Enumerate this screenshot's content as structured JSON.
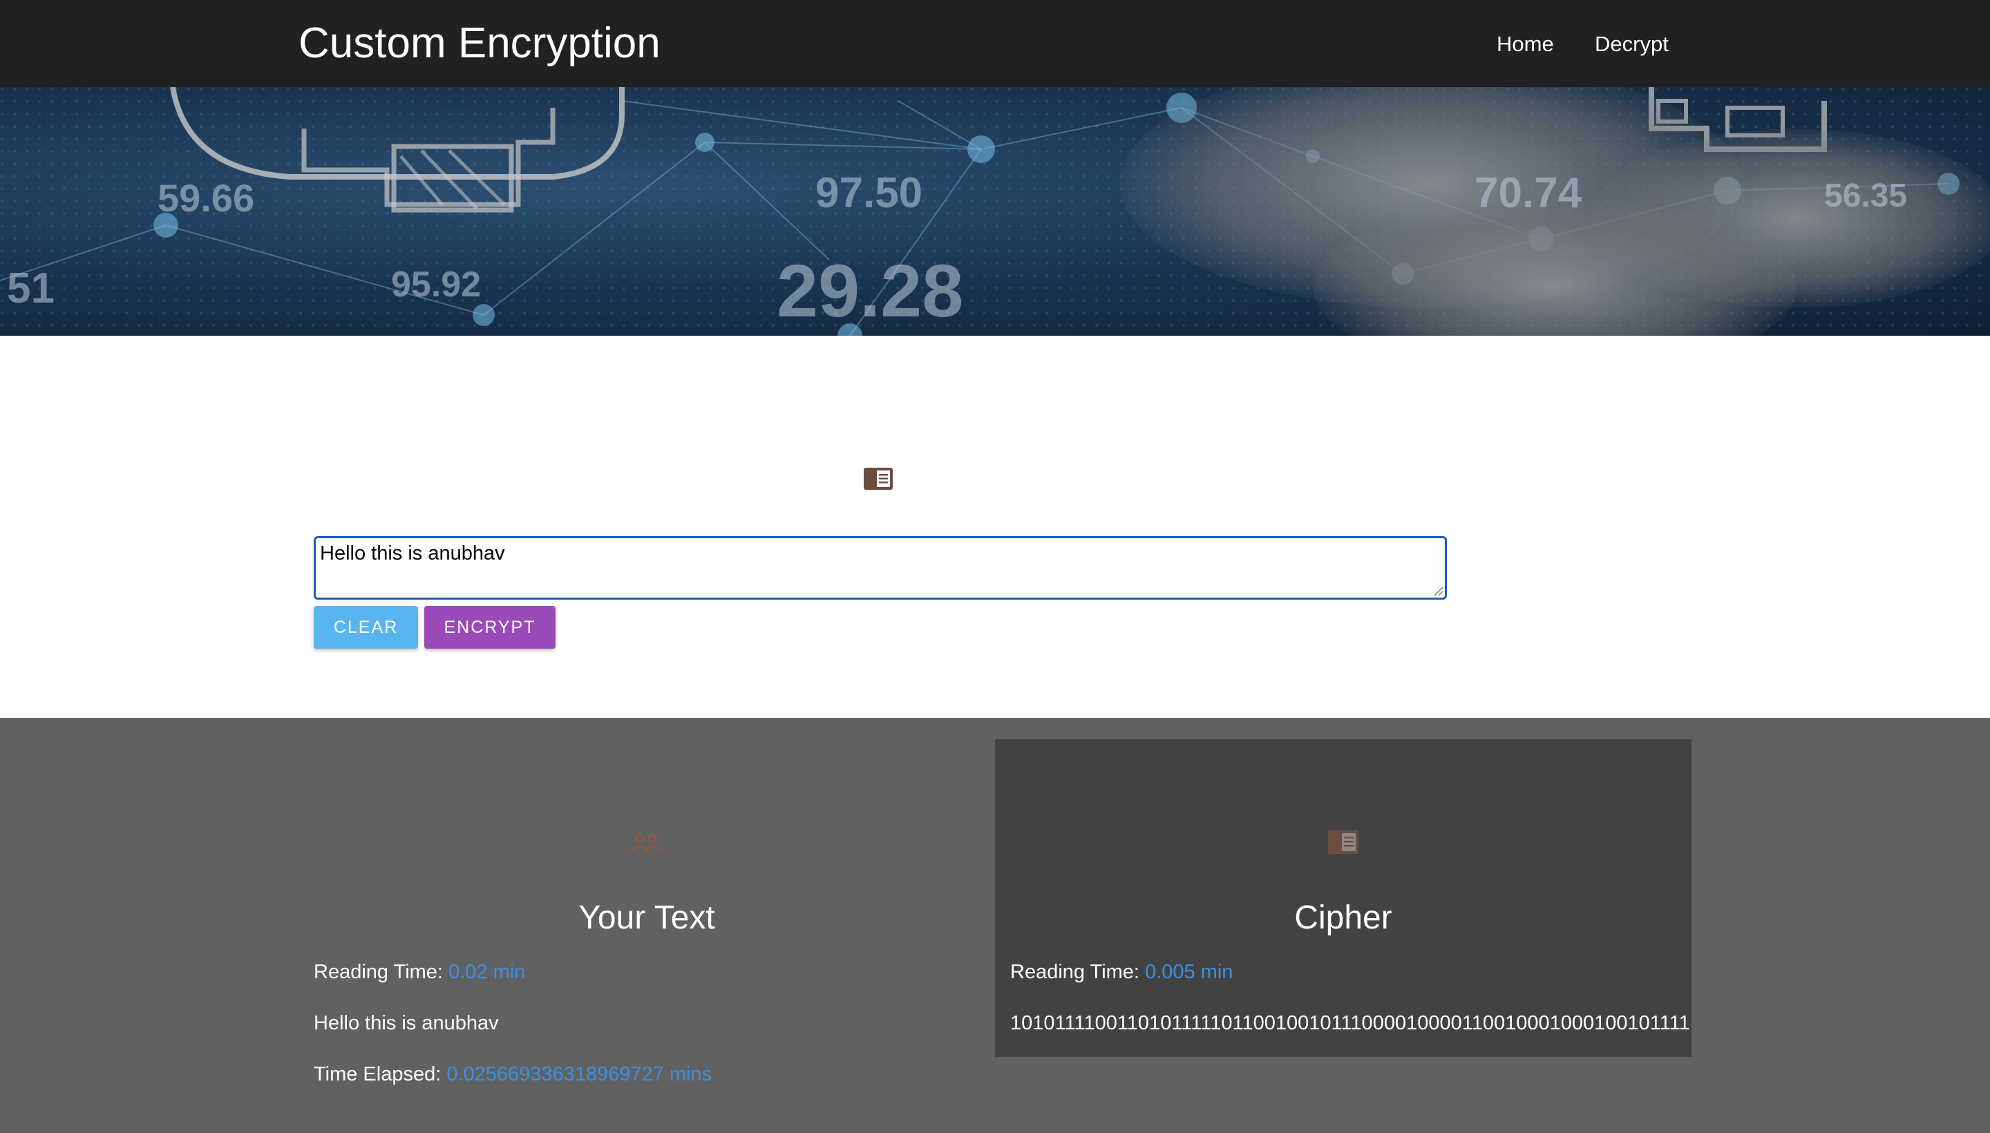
{
  "navbar": {
    "brand": "Custom Encryption",
    "links": [
      "Home",
      "Decrypt"
    ]
  },
  "hero": {
    "numbers": [
      "59.66",
      "97.50",
      "70.74",
      "56.35",
      "51",
      "95.92",
      "29.28"
    ]
  },
  "form": {
    "icon": "document-icon",
    "input_value": "Hello this is anubhav",
    "clear_label": "CLEAR",
    "encrypt_label": "ENCRYPT"
  },
  "results": {
    "your_text": {
      "icon": "people-icon",
      "title": "Your Text",
      "reading_time_label": "Reading Time:",
      "reading_time_value": "0.02 min",
      "text": "Hello this is anubhav",
      "time_elapsed_label": "Time Elapsed:",
      "time_elapsed_value": "0.025669336318969727 mins"
    },
    "cipher": {
      "icon": "document-icon",
      "title": "Cipher",
      "reading_time_label": "Reading Time:",
      "reading_time_value": "0.005 min",
      "text": "101011110011010111110110010010111000010000110010001000100101111"
    }
  },
  "colors": {
    "navbar_bg": "#212121",
    "results_bg": "#616161",
    "cipher_card_bg": "#424242",
    "clear_button": "#5ab5ee",
    "encrypt_button": "#9b4ab9",
    "accent_text": "#3d8fe0",
    "icon_brown": "#6d4c41"
  }
}
